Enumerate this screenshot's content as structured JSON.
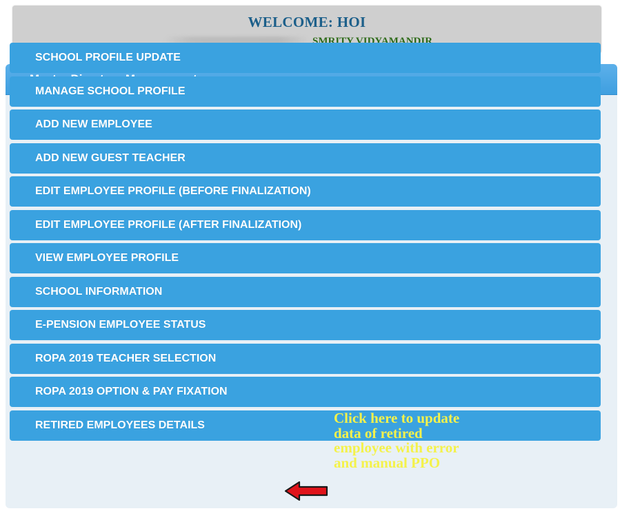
{
  "header": {
    "welcome": "WELCOME: HOI",
    "school": "SMRITY VIDYAMANDIR"
  },
  "panel": {
    "title": "Master Directory Management",
    "items": [
      "SCHOOL PROFILE UPDATE",
      "MANAGE SCHOOL PROFILE",
      "ADD NEW EMPLOYEE",
      "ADD NEW GUEST TEACHER",
      "EDIT EMPLOYEE PROFILE (BEFORE FINALIZATION)",
      "EDIT EMPLOYEE PROFILE (AFTER FINALIZATION)",
      "VIEW EMPLOYEE PROFILE",
      "SCHOOL INFORMATION",
      "E-PENSION EMPLOYEE STATUS",
      "ROPA 2019 TEACHER SELECTION",
      "ROPA 2019 OPTION & PAY FIXATION",
      "RETIRED EMPLOYEES DETAILS"
    ]
  },
  "annotation": {
    "lines": [
      "Click here to update",
      "data of retired",
      "employee with error",
      "and manual PPO"
    ],
    "color": "#f4f24b",
    "arrow_color": "#e0141b",
    "arrow_icon": "left-arrow-icon"
  },
  "colors": {
    "menu_item": "#3aa2e0",
    "panel_header": "#4aa8e6",
    "welcome_text": "#1c5f8a",
    "school_text": "#2e6b1a",
    "welcome_bg": "#cfcfcf"
  }
}
